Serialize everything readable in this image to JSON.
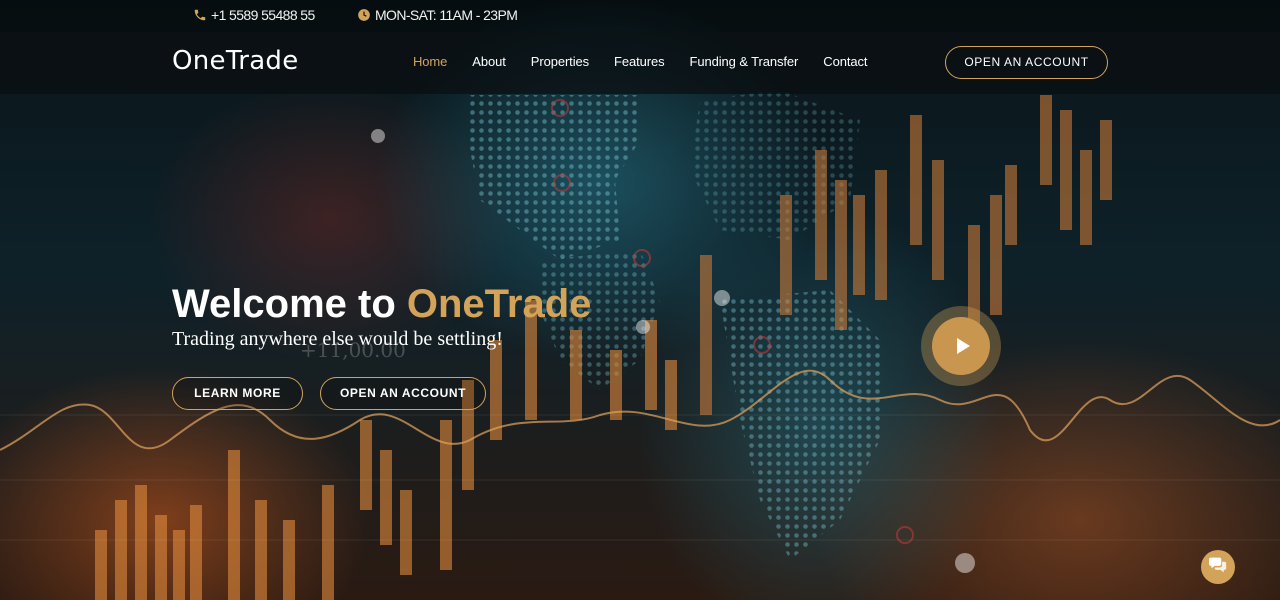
{
  "topbar": {
    "phone": "+1 5589 55488 55",
    "phone_icon": "phone-icon",
    "hours": "MON-SAT: 11AM - 23PM",
    "hours_icon": "clock-icon"
  },
  "navbar": {
    "brand": "OneTrade",
    "links": [
      "Home",
      "About",
      "Properties",
      "Features",
      "Funding & Transfer",
      "Contact"
    ],
    "active": "Home",
    "cta": "OPEN AN ACCOUNT"
  },
  "hero": {
    "title_prefix": "Welcome to ",
    "title_accent": "OneTrade",
    "subtitle": "Trading anywhere else would be settling!",
    "learn_more": "LEARN MORE",
    "open_account": "OPEN AN ACCOUNT",
    "background_text": "+11,00.00",
    "play_icon": "play-icon"
  },
  "chat": {
    "icon": "chat-icon"
  },
  "colors": {
    "accent": "#d4a35a",
    "navbar_bg": "#0a0e10"
  }
}
